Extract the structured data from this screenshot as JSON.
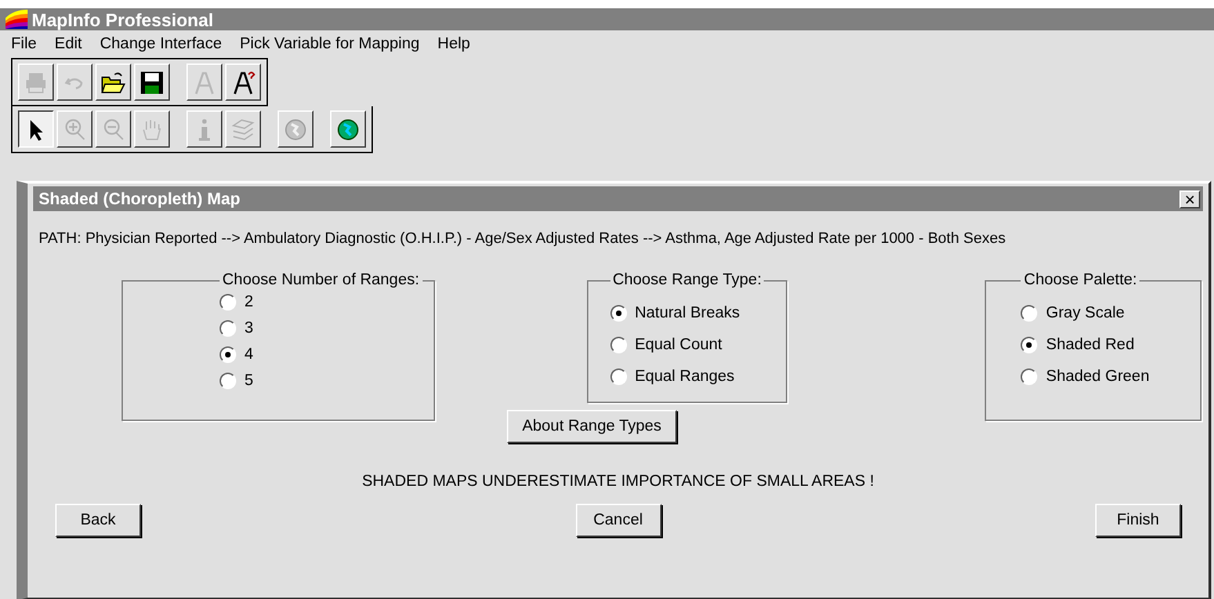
{
  "window": {
    "title": "MapInfo Professional"
  },
  "menu": [
    "File",
    "Edit",
    "Change Interface",
    "Pick Variable for Mapping",
    "Help"
  ],
  "toolbar_1": [
    {
      "kind": "print",
      "disabled": true
    },
    {
      "kind": "undo",
      "disabled": true
    },
    {
      "kind": "open",
      "disabled": false
    },
    {
      "kind": "save",
      "disabled": false
    },
    {
      "kind": "text-style",
      "disabled": true
    },
    {
      "kind": "text-help",
      "disabled": false
    }
  ],
  "toolbar_2": [
    {
      "kind": "pointer",
      "selected": true,
      "disabled": false
    },
    {
      "kind": "zoom-in",
      "selected": false,
      "disabled": true
    },
    {
      "kind": "zoom-out",
      "selected": false,
      "disabled": true
    },
    {
      "kind": "hand",
      "selected": false,
      "disabled": true
    },
    {
      "kind": "info",
      "selected": false,
      "disabled": true
    },
    {
      "kind": "layers",
      "selected": false,
      "disabled": true
    },
    {
      "kind": "globe",
      "selected": false,
      "disabled": true
    },
    {
      "kind": "globe",
      "selected": false,
      "disabled": false
    }
  ],
  "dialog": {
    "title": "Shaded (Choropleth) Map",
    "close": "×",
    "path": "PATH:  Physician Reported --> Ambulatory Diagnostic (O.H.I.P.) - Age/Sex Adjusted Rates --> Asthma, Age Adjusted Rate per 1000 - Both Sexes",
    "groups": [
      {
        "title": "Choose Number of Ranges:",
        "options": [
          {
            "label": "2",
            "selected": false
          },
          {
            "label": "3",
            "selected": false
          },
          {
            "label": "4",
            "selected": true
          },
          {
            "label": "5",
            "selected": false
          }
        ]
      },
      {
        "title": "Choose Range Type:",
        "options": [
          {
            "label": "Natural Breaks",
            "selected": true
          },
          {
            "label": "Equal Count",
            "selected": false
          },
          {
            "label": "Equal Ranges",
            "selected": false
          }
        ]
      },
      {
        "title": "Choose Palette:",
        "options": [
          {
            "label": "Gray Scale",
            "selected": false
          },
          {
            "label": "Shaded Red",
            "selected": true
          },
          {
            "label": "Shaded Green",
            "selected": false
          }
        ]
      }
    ],
    "about_button": "About Range Types",
    "warning": "SHADED MAPS UNDERESTIMATE IMPORTANCE OF SMALL AREAS !",
    "buttons": [
      "Back",
      "Cancel",
      "Finish"
    ]
  }
}
